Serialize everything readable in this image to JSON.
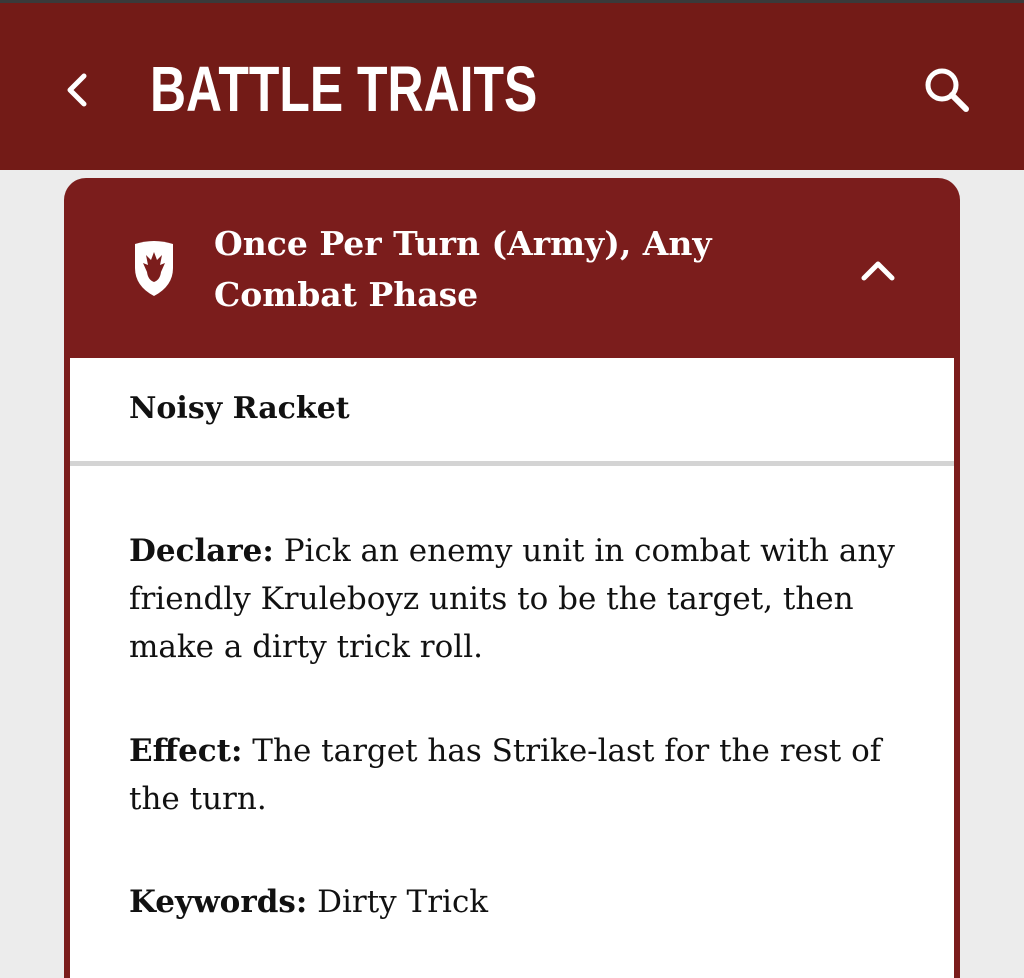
{
  "header": {
    "title": "BATTLE TRAITS",
    "back_icon": "chevron-left-icon",
    "search_icon": "search-icon",
    "background_color": "#731b17"
  },
  "card": {
    "phase_icon": "shield-flame-icon",
    "phase_title": "Once Per Turn (Army), Any Combat Phase",
    "collapse_icon": "chevron-up-icon",
    "header_color": "#7b1d1c",
    "ability_name": "Noisy Racket",
    "declare_label": "Declare:",
    "declare_text": "Pick an enemy unit in combat with any friendly Kruleboyz units to be the target, then make a dirty trick roll.",
    "effect_label": "Effect:",
    "effect_text": "The target has Strike-last for the rest of the turn.",
    "keywords_label": "Keywords:",
    "keywords_text": "Dirty Trick"
  }
}
